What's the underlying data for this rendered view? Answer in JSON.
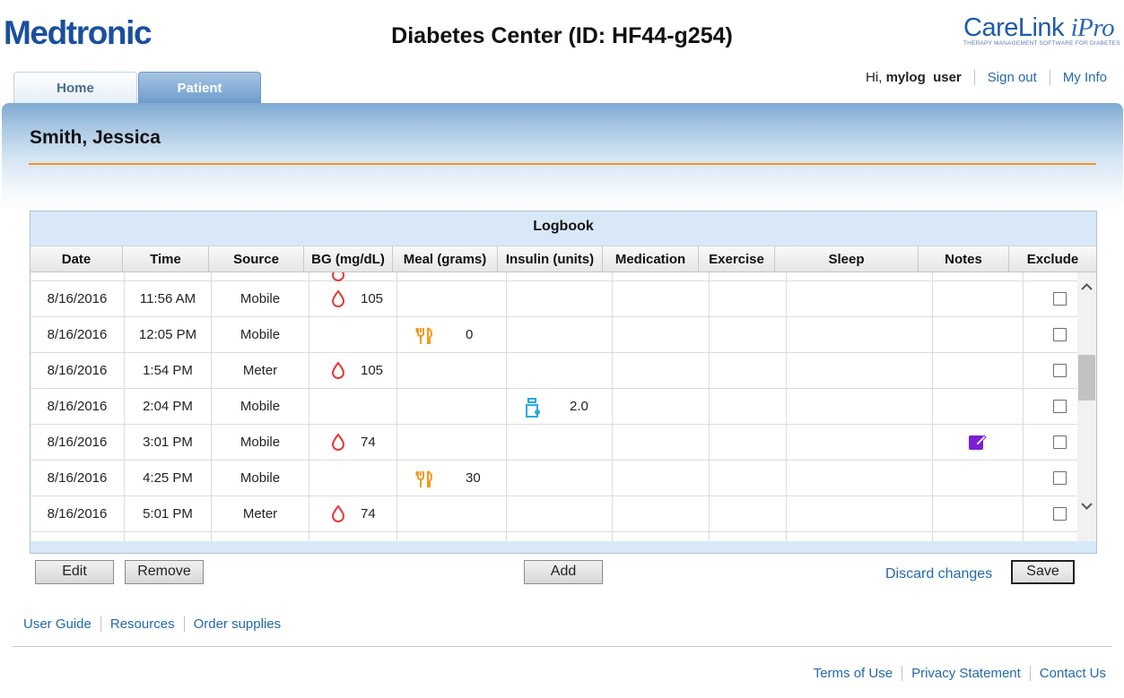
{
  "header": {
    "brand": "Medtronic",
    "title": "Diabetes Center (ID: HF44-g254)",
    "product_logo": {
      "main": "CareLink",
      "suffix": "iPro",
      "tagline": "THERAPY MANAGEMENT SOFTWARE FOR DIABETES"
    }
  },
  "tabs": [
    {
      "label": "Home",
      "active": false
    },
    {
      "label": "Patient",
      "active": true
    }
  ],
  "user_nav": {
    "greeting": "Hi,",
    "username": "mylog  user",
    "sign_out": "Sign out",
    "my_info": "My Info"
  },
  "patient": {
    "name": "Smith, Jessica"
  },
  "logbook": {
    "title": "Logbook",
    "columns": [
      "Date",
      "Time",
      "Source",
      "BG (mg/dL)",
      "Meal (grams)",
      "Insulin (units)",
      "Medication",
      "Exercise",
      "Sleep",
      "Notes",
      "Exclude"
    ],
    "rows": [
      {
        "date": "8/16/2016",
        "time": "11:56 AM",
        "source": "Mobile",
        "bg": "105",
        "meal": "",
        "insulin": "",
        "note": false,
        "exclude": false
      },
      {
        "date": "8/16/2016",
        "time": "12:05 PM",
        "source": "Mobile",
        "bg": "",
        "meal": "0",
        "insulin": "",
        "note": false,
        "exclude": false
      },
      {
        "date": "8/16/2016",
        "time": "1:54 PM",
        "source": "Meter",
        "bg": "105",
        "meal": "",
        "insulin": "",
        "note": false,
        "exclude": false
      },
      {
        "date": "8/16/2016",
        "time": "2:04 PM",
        "source": "Mobile",
        "bg": "",
        "meal": "",
        "insulin": "2.0",
        "note": false,
        "exclude": false
      },
      {
        "date": "8/16/2016",
        "time": "3:01 PM",
        "source": "Mobile",
        "bg": "74",
        "meal": "",
        "insulin": "",
        "note": true,
        "exclude": false
      },
      {
        "date": "8/16/2016",
        "time": "4:25 PM",
        "source": "Mobile",
        "bg": "",
        "meal": "30",
        "insulin": "",
        "note": false,
        "exclude": false
      },
      {
        "date": "8/16/2016",
        "time": "5:01 PM",
        "source": "Meter",
        "bg": "74",
        "meal": "",
        "insulin": "",
        "note": false,
        "exclude": false
      }
    ],
    "icons": {
      "bg": "blood-drop-icon",
      "meal": "meal-utensils-icon",
      "insulin": "insulin-vial-icon",
      "note": "note-edit-icon"
    }
  },
  "actions": {
    "edit": "Edit",
    "remove": "Remove",
    "add": "Add",
    "discard": "Discard changes",
    "save": "Save"
  },
  "bottom_links": [
    "User Guide",
    "Resources",
    "Order supplies"
  ],
  "footer_links": [
    "Terms of Use",
    "Privacy Statement",
    "Contact Us"
  ],
  "colors": {
    "brand_blue": "#1a4f9c",
    "accent_orange": "#f2961b",
    "bg_drop": "#e53935",
    "meal_icon": "#f59a1b",
    "insulin_icon": "#29a9e0",
    "note_icon": "#7b1fd6",
    "link": "#2369ac"
  }
}
